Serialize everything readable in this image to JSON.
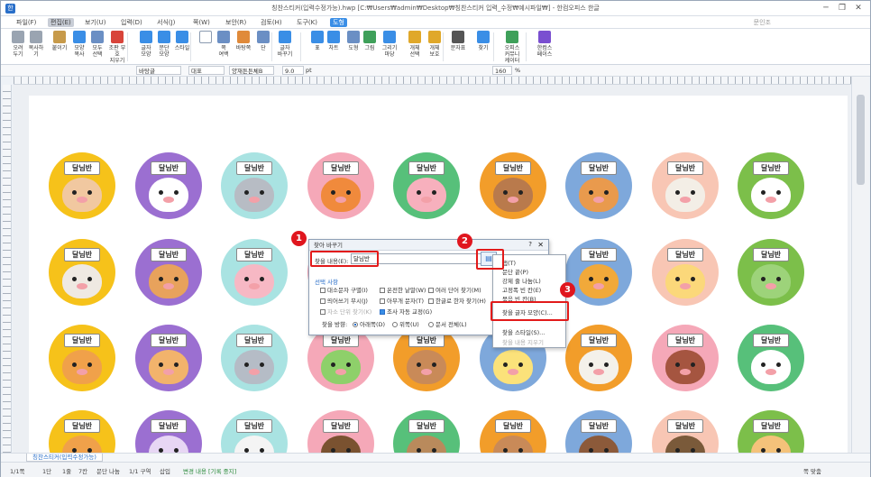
{
  "window": {
    "title": "칭찬스티커(입력수정가능).hwp [C:₩Users₩admin₩Desktop₩칭찬스티커 입력_수정₩예시파일₩] - 한컴오피스 한글",
    "controls": [
      "─",
      "❐",
      "✕"
    ]
  },
  "menu": {
    "items": [
      "파일(F)",
      "편집(E)",
      "보기(U)",
      "입력(D)",
      "서식(J)",
      "쪽(W)",
      "보안(R)",
      "검토(H)",
      "도구(K)",
      "도형"
    ],
    "user": "문인조"
  },
  "ribbon": {
    "buttons": [
      {
        "label": "오려\n두기",
        "icon": "scissors-icon",
        "color": "#9aa4b1"
      },
      {
        "label": "복사하기",
        "icon": "copy-icon",
        "color": "#9aa4b1"
      },
      {
        "label": "붙이기",
        "icon": "paste-icon",
        "color": "#c79a4a"
      },
      {
        "label": "모양\n복사",
        "icon": "format-painter-icon",
        "color": "#3a8ee6"
      },
      {
        "label": "모두\n선택",
        "icon": "select-all-icon",
        "color": "#6b8fc4"
      },
      {
        "label": "조판 부호\n지우기",
        "icon": "clear-codes-icon",
        "color": "#d8443a"
      },
      {
        "label": "글자\n모양",
        "icon": "char-shape-icon",
        "color": "#3a8ee6"
      },
      {
        "label": "문단\n모양",
        "icon": "para-shape-icon",
        "color": "#3a8ee6"
      },
      {
        "label": "스타일",
        "icon": "style-icon",
        "color": "#3a8ee6"
      },
      {
        "label": "",
        "icon": "page-icon",
        "color": "#ffffff"
      },
      {
        "label": "쪽\n여백",
        "icon": "margin-icon",
        "color": "#6b8fc4"
      },
      {
        "label": "바탕쪽",
        "icon": "master-page-icon",
        "color": "#e08a3a"
      },
      {
        "label": "단",
        "icon": "columns-icon",
        "color": "#6b8fc4"
      },
      {
        "label": "글자\n바꾸기",
        "icon": "replace-icon",
        "color": "#3a8ee6"
      },
      {
        "label": "표",
        "icon": "table-icon",
        "color": "#3a8ee6"
      },
      {
        "label": "차트",
        "icon": "chart-icon",
        "color": "#3a8ee6"
      },
      {
        "label": "도형",
        "icon": "shape-icon",
        "color": "#6b8fc4"
      },
      {
        "label": "그림",
        "icon": "picture-icon",
        "color": "#3fa05a"
      },
      {
        "label": "그리기마당",
        "icon": "clipart-icon",
        "color": "#3a8ee6"
      },
      {
        "label": "개체\n선택",
        "icon": "object-select-icon",
        "color": "#e0a82a"
      },
      {
        "label": "개체\n보호",
        "icon": "object-protect-icon",
        "color": "#e0a82a"
      },
      {
        "label": "문자표",
        "icon": "symbol-icon",
        "color": "#555555"
      },
      {
        "label": "찾기",
        "icon": "find-icon",
        "color": "#3a8ee6"
      },
      {
        "label": "오피스\n커뮤니케이터",
        "icon": "communicator-icon",
        "color": "#3fa05a"
      },
      {
        "label": "한컴스페이스",
        "icon": "hancom-space-icon",
        "color": "#7a4fd0"
      }
    ]
  },
  "format_bar": {
    "style": "바탕글",
    "lang": "대표",
    "font": "양재튼튼체B",
    "size": "9.0",
    "unit": "pt",
    "zoom": "160",
    "zoom_unit": "%"
  },
  "stickers": {
    "tag_text": "달님반",
    "rows": [
      [
        {
          "bg": "#f6c21a",
          "face": "#f1c8a0"
        },
        {
          "bg": "#9b6fd1",
          "face": "#ffffff"
        },
        {
          "bg": "#a9e3e2",
          "face": "#b7bcc4"
        },
        {
          "bg": "#f5a8b8",
          "face": "#f08a3c"
        },
        {
          "bg": "#57c07a",
          "face": "#f7b0bd"
        },
        {
          "bg": "#f29d2a",
          "face": "#b97a4c"
        },
        {
          "bg": "#7ea8db",
          "face": "#e99a4d"
        },
        {
          "bg": "#f8c6b4",
          "face": "#f3eee6"
        },
        {
          "bg": "#7cbf4a",
          "face": "#ffffff"
        }
      ],
      [
        {
          "bg": "#f6c21a",
          "face": "#efe9e2"
        },
        {
          "bg": "#9b6fd1",
          "face": "#e8a25c"
        },
        {
          "bg": "#a9e3e2",
          "face": "#f7b8c4"
        },
        {
          "bg": "#f5a8b8",
          "face": "#f6d49a"
        },
        {
          "bg": "#57c07a",
          "face": "#f6d49a"
        },
        {
          "bg": "#f29d2a",
          "face": "#f3c27a"
        },
        {
          "bg": "#7ea8db",
          "face": "#f1a93a"
        },
        {
          "bg": "#f8c6b4",
          "face": "#fbd87a"
        },
        {
          "bg": "#7cbf4a",
          "face": "#9dd37a"
        }
      ],
      [
        {
          "bg": "#f6c21a",
          "face": "#f0a14a"
        },
        {
          "bg": "#9b6fd1",
          "face": "#f2b36c"
        },
        {
          "bg": "#a9e3e2",
          "face": "#b5bcc6"
        },
        {
          "bg": "#f5a8b8",
          "face": "#8ed06a"
        },
        {
          "bg": "#f29d2a",
          "face": "#c98a58"
        },
        {
          "bg": "#7ea8db",
          "face": "#fbe27a"
        },
        {
          "bg": "#f29d2a",
          "face": "#f4f1ea"
        },
        {
          "bg": "#f5a8b8",
          "face": "#a55540"
        },
        {
          "bg": "#57c07a",
          "face": "#ffffff"
        }
      ],
      [
        {
          "bg": "#f6c21a",
          "face": "#f0a14a"
        },
        {
          "bg": "#9b6fd1",
          "face": "#e7d6f4"
        },
        {
          "bg": "#a9e3e2",
          "face": "#f4f4f4"
        },
        {
          "bg": "#f5a8b8",
          "face": "#7a5230"
        },
        {
          "bg": "#57c07a",
          "face": "#b98a5c"
        },
        {
          "bg": "#f29d2a",
          "face": "#c98a58"
        },
        {
          "bg": "#7ea8db",
          "face": "#8c5a3a"
        },
        {
          "bg": "#f8c6b4",
          "face": "#7a5a3a"
        },
        {
          "bg": "#7cbf4a",
          "face": "#f4c27a"
        }
      ]
    ]
  },
  "dialog": {
    "title": "찾아 바꾸기",
    "help": "?",
    "close": "✕",
    "find_label": "찾을 내용(E):",
    "find_value": "달님반",
    "options_title": "선택 사항",
    "options": [
      {
        "label": "대소문자 구별(I)",
        "checked": false
      },
      {
        "label": "온전한 낱말(W)",
        "checked": false
      },
      {
        "label": "여러 단어 찾기(M)",
        "checked": false
      },
      {
        "label": "띄어쓰기 무시(J)",
        "checked": false
      },
      {
        "label": "아무개 문자(T)",
        "checked": false
      },
      {
        "label": "한글로 한자 찾기(H)",
        "checked": false
      },
      {
        "label": "자소 단위 찾기(K)",
        "checked": false
      },
      {
        "label": "조사 자동 교정(G)",
        "checked": true
      }
    ],
    "direction_label": "찾을 방향:",
    "directions": [
      {
        "label": "아래쪽(D)",
        "selected": true
      },
      {
        "label": "위쪽(U)",
        "selected": false
      },
      {
        "label": "문서 전체(L)",
        "selected": false
      }
    ]
  },
  "context_menu": {
    "items": [
      {
        "label": "탭(T)",
        "disabled": false
      },
      {
        "label": "문단 끝(P)",
        "disabled": false
      },
      {
        "label": "강제 줄 나눔(L)",
        "disabled": false
      },
      {
        "label": "고정폭 빈 칸(E)",
        "disabled": false
      },
      {
        "label": "묶음 빈 칸(B)",
        "disabled": false
      },
      {
        "label": "찾을 글자 모양(C)...",
        "disabled": false
      },
      {
        "label": "찾을 스타일(S)...",
        "disabled": false
      },
      {
        "label": "찾을 내용 지우기",
        "disabled": true
      }
    ]
  },
  "callouts": [
    "1",
    "2",
    "3"
  ],
  "sheet_tab": "칭찬스티커(입력수정가능)",
  "status": {
    "items": [
      "1/1쪽",
      "1단",
      "1줄",
      "7칸",
      "문단 나눔",
      "1/1 구역",
      "삽입"
    ],
    "change_tracking": "변경 내용 [기록 중지]",
    "view_label": "쪽 맞춤"
  }
}
